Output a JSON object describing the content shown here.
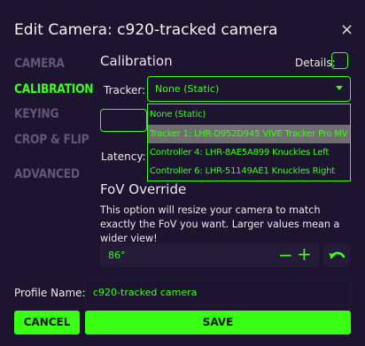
{
  "dialog": {
    "title": "Edit Camera: c920-tracked camera",
    "close_label": "×"
  },
  "sidebar": {
    "items": [
      {
        "label": "CAMERA",
        "active": false
      },
      {
        "label": "CALIBRATION",
        "active": true
      },
      {
        "label": "KEYING",
        "active": false
      },
      {
        "label": "CROP & FLIP",
        "active": false
      },
      {
        "label": "ADVANCED",
        "active": false
      }
    ]
  },
  "calibration": {
    "title": "Calibration",
    "details_label": "Details:",
    "tracker_label": "Tracker:",
    "tracker_selected": "None (Static)",
    "latency_label": "Latency:",
    "dropdown_options": [
      "None (Static)",
      "Tracker 1: LHR-D952D945 VIVE Tracker Pro MV",
      "Controller 4: LHR-8AE5A899 Knuckles Left",
      "Controller 6: LHR-51149AE1 Knuckles Right"
    ],
    "highlighted_option_index": 1
  },
  "fov": {
    "title": "FoV Override",
    "description": "This option will resize your camera to match exactly the FoV you want. Larger values mean a wider view!",
    "value": "86°",
    "minus_label": "−",
    "plus_label": "+"
  },
  "profile": {
    "label": "Profile Name:",
    "value": "c920-tracked camera"
  },
  "buttons": {
    "cancel": "CANCEL",
    "save": "SAVE"
  },
  "colors": {
    "accent": "#39ff14",
    "background": "#1d1530",
    "highlight": "#6f6f6f"
  },
  "icons": {
    "close": "close-icon",
    "dropdown": "chevron-down-icon",
    "reset": "undo-icon"
  }
}
